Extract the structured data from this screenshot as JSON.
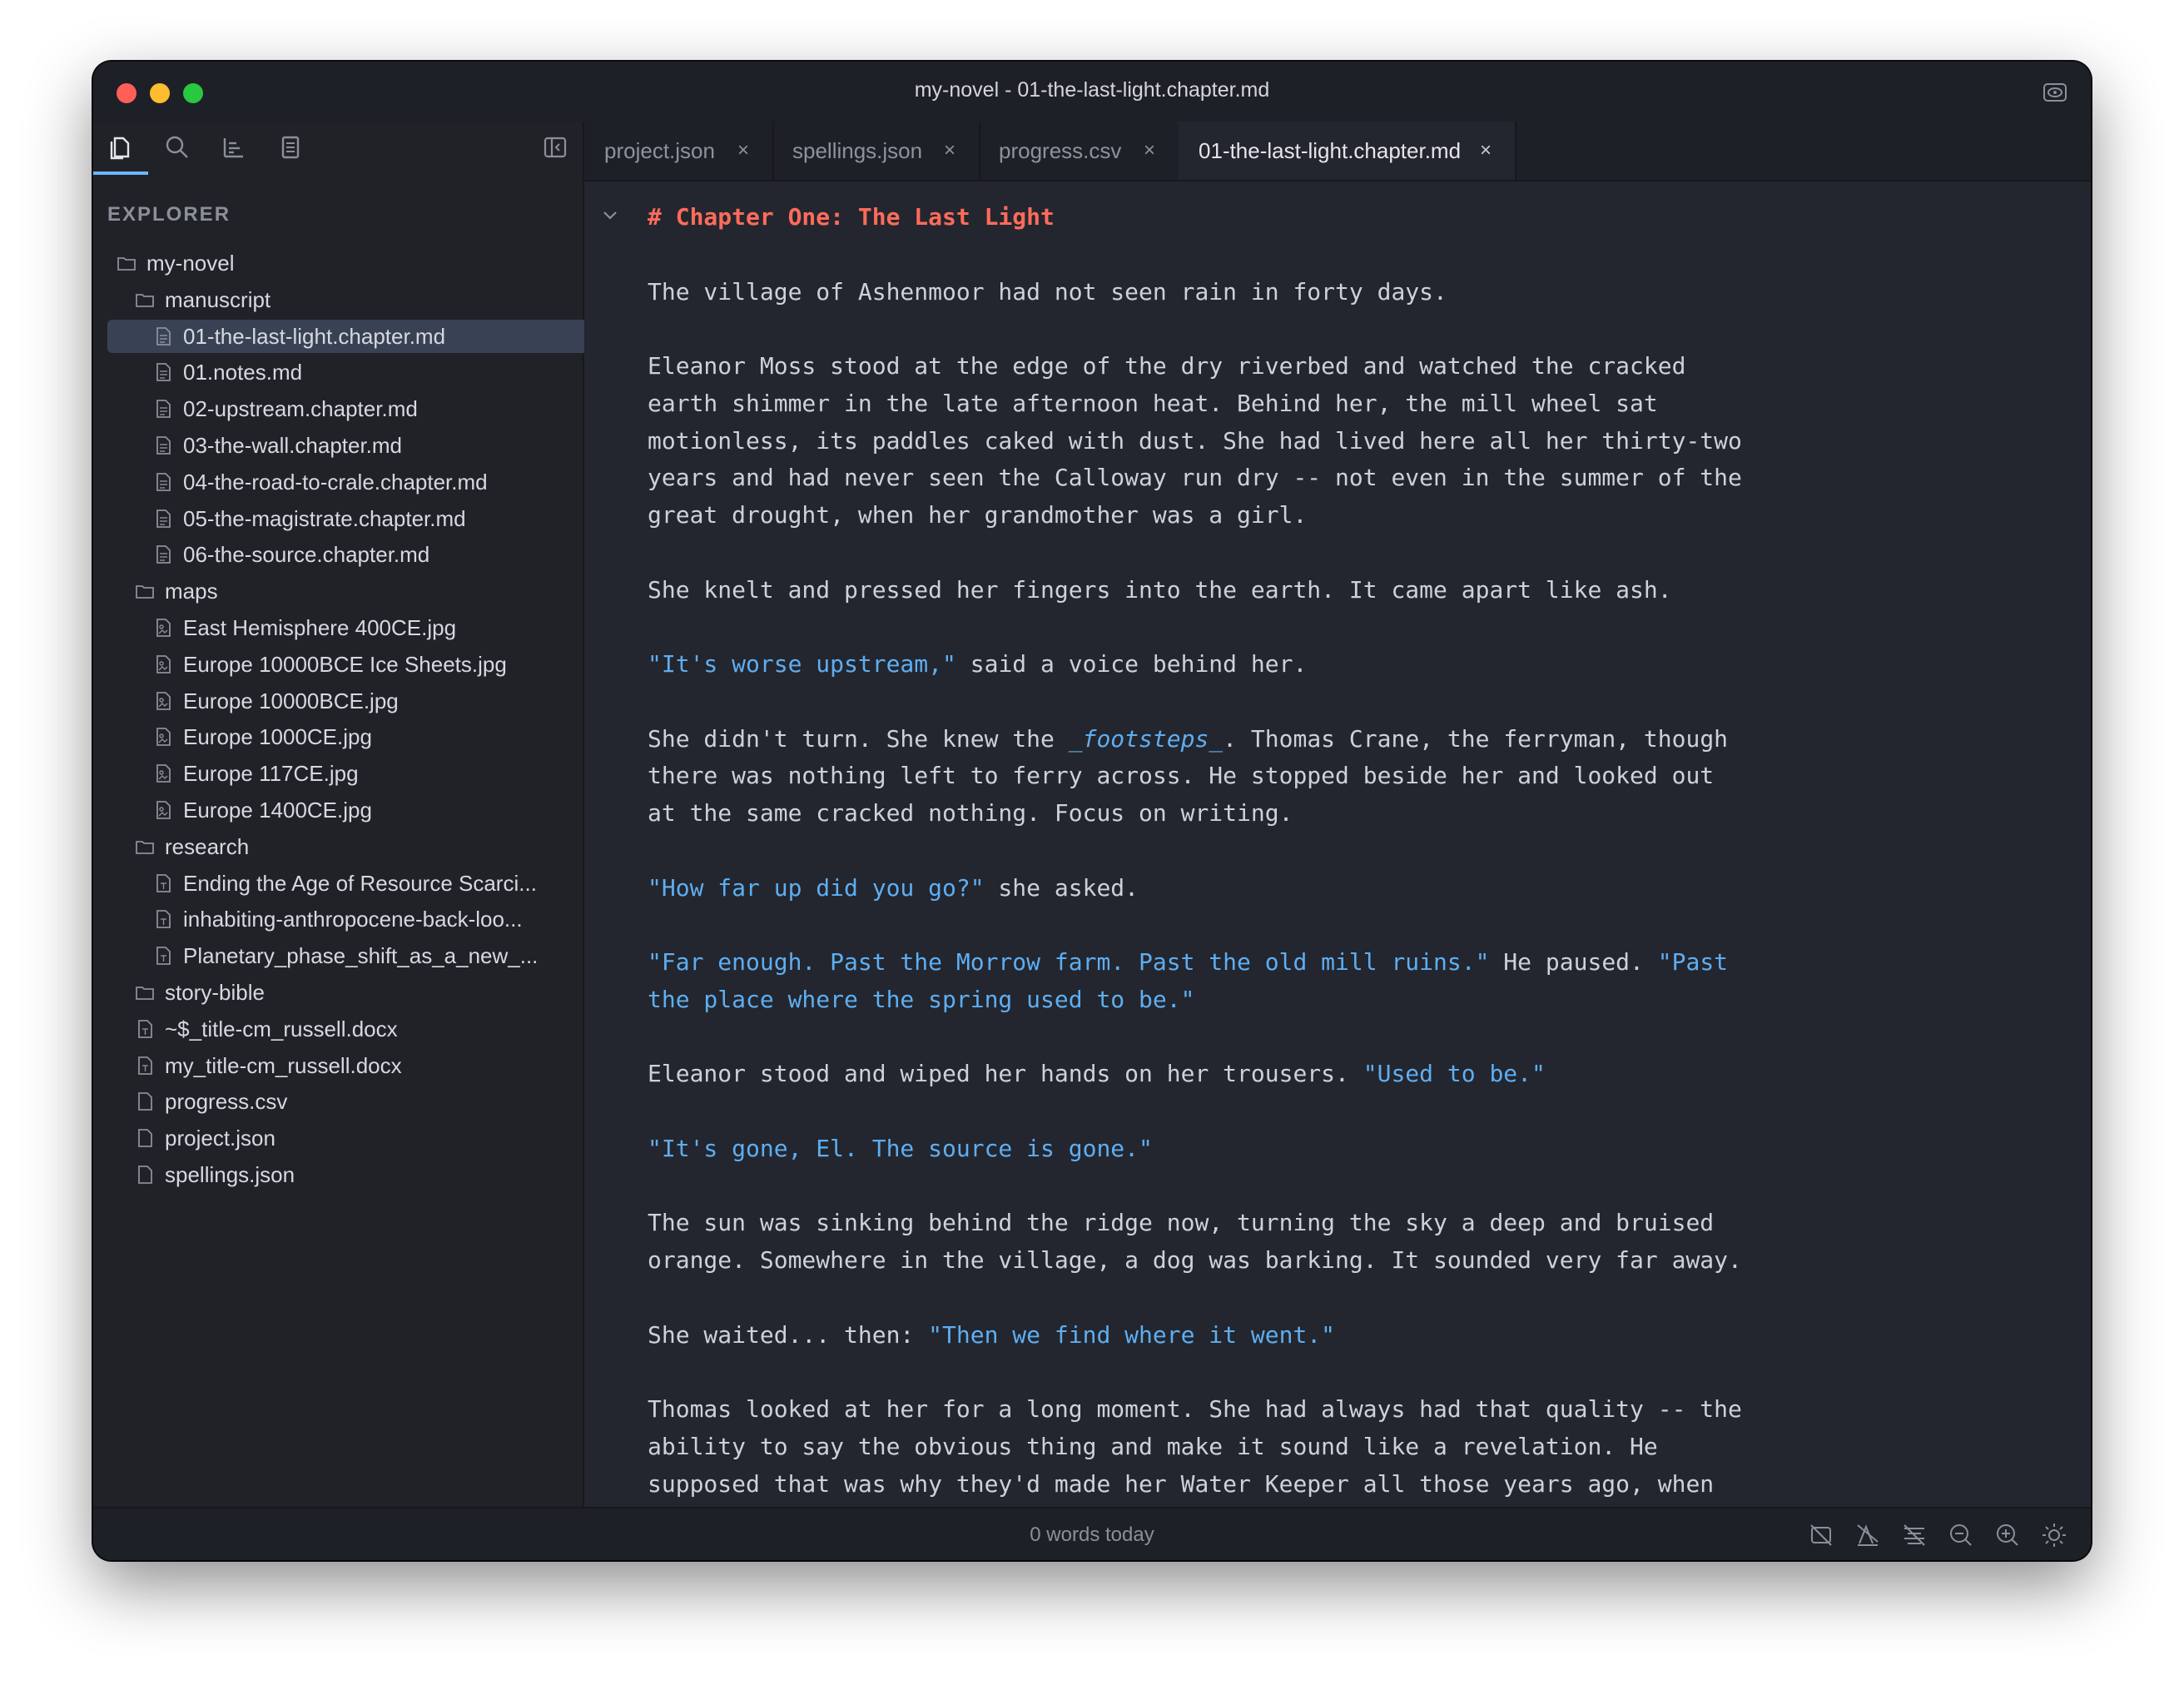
{
  "window": {
    "title": "my-novel - 01-the-last-light.chapter.md"
  },
  "sidebar": {
    "toolbar": [
      "files-icon",
      "search-icon",
      "outline-icon",
      "bookmark-icon",
      "collapse-sidebar-icon"
    ],
    "explorer_label": "EXPLORER",
    "tree": [
      {
        "label": "my-novel",
        "type": "folder",
        "depth": 0
      },
      {
        "label": "manuscript",
        "type": "folder",
        "depth": 1
      },
      {
        "label": "01-the-last-light.chapter.md",
        "type": "file-text",
        "depth": 2,
        "selected": true
      },
      {
        "label": "01.notes.md",
        "type": "file-text",
        "depth": 2
      },
      {
        "label": "02-upstream.chapter.md",
        "type": "file-text",
        "depth": 2
      },
      {
        "label": "03-the-wall.chapter.md",
        "type": "file-text",
        "depth": 2
      },
      {
        "label": "04-the-road-to-crale.chapter.md",
        "type": "file-text",
        "depth": 2
      },
      {
        "label": "05-the-magistrate.chapter.md",
        "type": "file-text",
        "depth": 2
      },
      {
        "label": "06-the-source.chapter.md",
        "type": "file-text",
        "depth": 2
      },
      {
        "label": "maps",
        "type": "folder",
        "depth": 1
      },
      {
        "label": "East Hemisphere 400CE.jpg",
        "type": "file-image",
        "depth": 2
      },
      {
        "label": "Europe 10000BCE Ice Sheets.jpg",
        "type": "file-image",
        "depth": 2
      },
      {
        "label": "Europe 10000BCE.jpg",
        "type": "file-image",
        "depth": 2
      },
      {
        "label": "Europe 1000CE.jpg",
        "type": "file-image",
        "depth": 2
      },
      {
        "label": "Europe 117CE.jpg",
        "type": "file-image",
        "depth": 2
      },
      {
        "label": "Europe 1400CE.jpg",
        "type": "file-image",
        "depth": 2
      },
      {
        "label": "research",
        "type": "folder",
        "depth": 1
      },
      {
        "label": "Ending the Age of Resource Scarci...",
        "type": "file-doc",
        "depth": 2
      },
      {
        "label": "inhabiting-anthropocene-back-loo...",
        "type": "file-doc",
        "depth": 2
      },
      {
        "label": "Planetary_phase_shift_as_a_new_...",
        "type": "file-doc",
        "depth": 2
      },
      {
        "label": "story-bible",
        "type": "folder",
        "depth": 1
      },
      {
        "label": "~$_title-cm_russell.docx",
        "type": "file-doc",
        "depth": 1
      },
      {
        "label": "my_title-cm_russell.docx",
        "type": "file-doc",
        "depth": 1
      },
      {
        "label": "progress.csv",
        "type": "file",
        "depth": 1
      },
      {
        "label": "project.json",
        "type": "file",
        "depth": 1
      },
      {
        "label": "spellings.json",
        "type": "file",
        "depth": 1
      }
    ]
  },
  "tabs": [
    {
      "label": "project.json",
      "active": false
    },
    {
      "label": "spellings.json",
      "active": false
    },
    {
      "label": "progress.csv",
      "active": false
    },
    {
      "label": "01-the-last-light.chapter.md",
      "active": true
    }
  ],
  "tab_close_glyph": "×",
  "editor": {
    "lines": [
      [
        {
          "t": "# Chapter One: The Last Light",
          "c": "heading"
        }
      ],
      [],
      [
        {
          "t": "The village of Ashenmoor had not seen rain in forty days."
        }
      ],
      [],
      [
        {
          "t": "Eleanor Moss stood at the edge of the dry riverbed and watched the cracked"
        }
      ],
      [
        {
          "t": "earth shimmer in the late afternoon heat. Behind her, the mill wheel sat"
        }
      ],
      [
        {
          "t": "motionless, its paddles caked with dust. She had lived here all her thirty-two"
        }
      ],
      [
        {
          "t": "years and had never seen the Calloway run dry -- not even in the summer of the"
        }
      ],
      [
        {
          "t": "great drought, when her grandmother was a girl."
        }
      ],
      [],
      [
        {
          "t": "She knelt and pressed her fingers into the earth. It came apart like ash."
        }
      ],
      [],
      [
        {
          "t": "\"It's worse upstream,\"",
          "c": "quote"
        },
        {
          "t": " said a voice behind her."
        }
      ],
      [],
      [
        {
          "t": "She didn't turn. She knew the "
        },
        {
          "t": "_footsteps_",
          "c": "em"
        },
        {
          "t": ". Thomas Crane, the ferryman, though"
        }
      ],
      [
        {
          "t": "there was nothing left to ferry across. He stopped beside her and looked out"
        }
      ],
      [
        {
          "t": "at the same cracked nothing. Focus on writing."
        }
      ],
      [],
      [
        {
          "t": "\"How far up did you go?\"",
          "c": "quote"
        },
        {
          "t": " she asked."
        }
      ],
      [],
      [
        {
          "t": "\"Far enough. Past the Morrow farm. Past the old mill ruins.\"",
          "c": "quote"
        },
        {
          "t": " He paused. "
        },
        {
          "t": "\"Past",
          "c": "quote"
        }
      ],
      [
        {
          "t": "the place where the spring used to be.\"",
          "c": "quote"
        }
      ],
      [],
      [
        {
          "t": "Eleanor stood and wiped her hands on her trousers. "
        },
        {
          "t": "\"Used to be.\"",
          "c": "quote"
        }
      ],
      [],
      [
        {
          "t": "\"It's gone, El. The source is gone.\"",
          "c": "quote"
        }
      ],
      [],
      [
        {
          "t": "The sun was sinking behind the ridge now, turning the sky a deep and bruised"
        }
      ],
      [
        {
          "t": "orange. Somewhere in the village, a dog was barking. It sounded very far away."
        }
      ],
      [],
      [
        {
          "t": "She waited... then: "
        },
        {
          "t": "\"Then we find where it went.\"",
          "c": "quote"
        }
      ],
      [],
      [
        {
          "t": "Thomas looked at her for a long moment. She had always had that quality -- the"
        }
      ],
      [
        {
          "t": "ability to say the obvious thing and make it sound like a revelation. He"
        }
      ],
      [
        {
          "t": "supposed that was why they'd made her Water Keeper all those years ago, when"
        }
      ]
    ]
  },
  "status": {
    "text": "0 words today",
    "icons": [
      "focus-mode-off-icon",
      "typewriter-off-icon",
      "spellcheck-off-icon",
      "zoom-out-icon",
      "zoom-in-icon",
      "theme-icon"
    ]
  }
}
